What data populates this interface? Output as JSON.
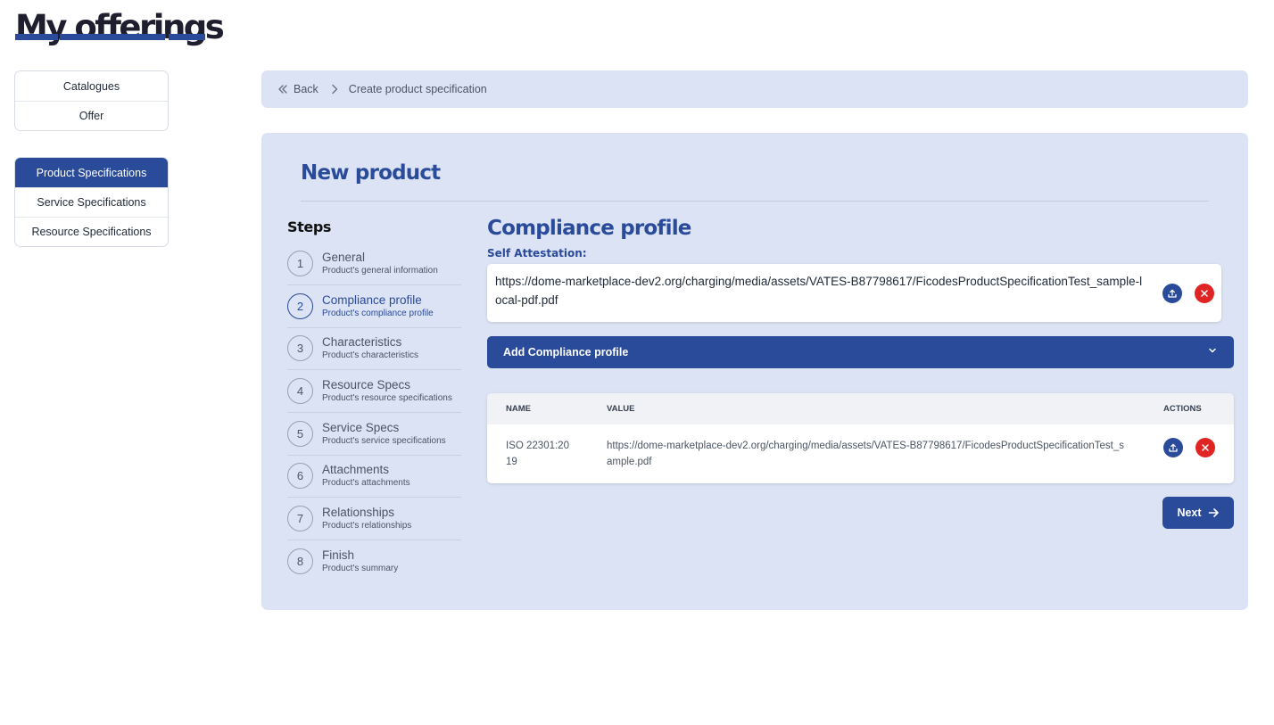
{
  "page": {
    "title": "My offerings"
  },
  "sidebar": {
    "group1": [
      {
        "label": "Catalogues",
        "active": false
      },
      {
        "label": "Offer",
        "active": false
      }
    ],
    "group2": [
      {
        "label": "Product Specifications",
        "active": true
      },
      {
        "label": "Service Specifications",
        "active": false
      },
      {
        "label": "Resource Specifications",
        "active": false
      }
    ]
  },
  "breadcrumb": {
    "back": "Back",
    "current": "Create product specification"
  },
  "panel": {
    "title": "New product",
    "steps_title": "Steps",
    "current_step": 2,
    "steps": [
      {
        "num": "1",
        "name": "General",
        "desc": "Product's general information"
      },
      {
        "num": "2",
        "name": "Compliance profile",
        "desc": "Product's compliance profile"
      },
      {
        "num": "3",
        "name": "Characteristics",
        "desc": "Product's characteristics"
      },
      {
        "num": "4",
        "name": "Resource Specs",
        "desc": "Product's resource specifications"
      },
      {
        "num": "5",
        "name": "Service Specs",
        "desc": "Product's service specifications"
      },
      {
        "num": "6",
        "name": "Attachments",
        "desc": "Product's attachments"
      },
      {
        "num": "7",
        "name": "Relationships",
        "desc": "Product's relationships"
      },
      {
        "num": "8",
        "name": "Finish",
        "desc": "Product's summary"
      }
    ]
  },
  "compliance": {
    "title": "Compliance profile",
    "self_attestation_label": "Self Attestation:",
    "self_attestation_url": "https://dome-marketplace-dev2.org/charging/media/assets/VATES-B87798617/FicodesProductSpecificationTest_sample-local-pdf.pdf",
    "add_label": "Add Compliance profile",
    "table": {
      "headers": {
        "name": "NAME",
        "value": "VALUE",
        "actions": "ACTIONS"
      },
      "rows": [
        {
          "name": "ISO 22301:2019",
          "value": "https://dome-marketplace-dev2.org/charging/media/assets/VATES-B87798617/FicodesProductSpecificationTest_sample.pdf"
        }
      ]
    },
    "next_label": "Next"
  },
  "colors": {
    "primary": "#2a4a9a",
    "panel_bg": "#dbe3f4",
    "danger": "#e02424"
  },
  "icons": [
    "chevrons-left-icon",
    "chevron-right-icon",
    "upload-icon",
    "close-icon",
    "chevron-down-icon",
    "arrow-right-icon"
  ]
}
